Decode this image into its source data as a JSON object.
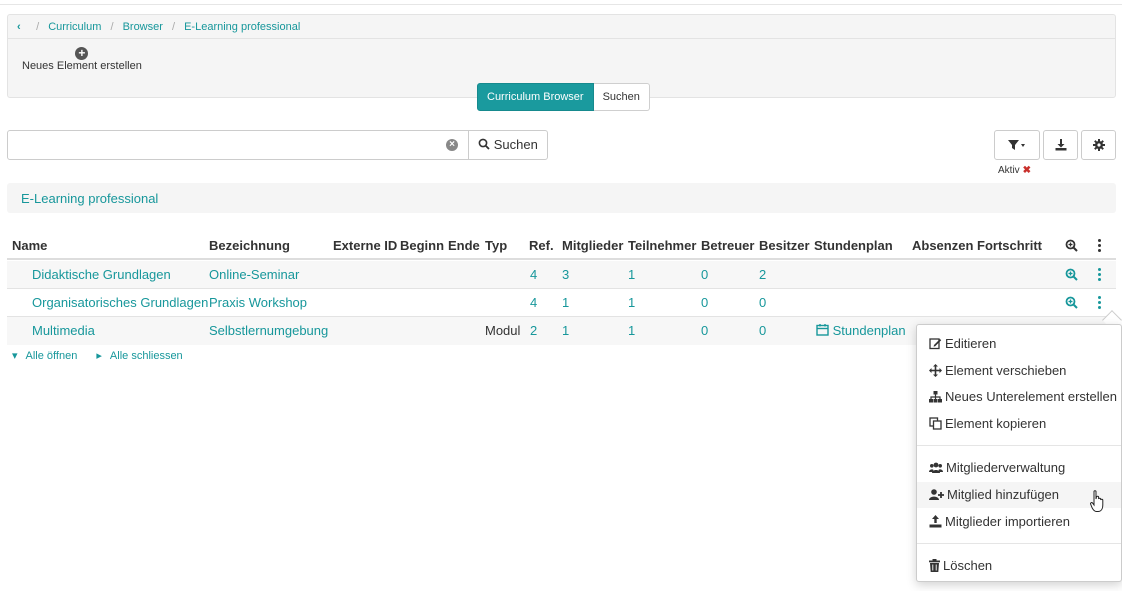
{
  "breadcrumb": [
    "Curriculum",
    "Browser",
    "E-Learning professional"
  ],
  "toolbar": {
    "new_element_label": "Neues Element erstellen"
  },
  "view_tabs": [
    {
      "label": "Curriculum Browser",
      "active": true
    },
    {
      "label": "Suchen",
      "active": false
    }
  ],
  "search": {
    "value": "",
    "placeholder": "",
    "button_label": "Suchen"
  },
  "filter": {
    "status_label": "Aktiv"
  },
  "section_title": "E-Learning professional",
  "table": {
    "headers": [
      "Name",
      "Bezeichnung",
      "Externe ID",
      "Beginn",
      "Ende",
      "Typ",
      "Ref.",
      "Mitglieder",
      "Teilnehmer",
      "Betreuer",
      "Besitzer",
      "Stundenplan",
      "Absenzen",
      "Fortschritt"
    ],
    "rows": [
      {
        "name": "Didaktische Grundlagen",
        "bezeichnung": "Online-Seminar",
        "typ": "",
        "ref": "4",
        "mitglieder": "3",
        "teilnehmer": "1",
        "betreuer": "0",
        "besitzer": "2",
        "stundenplan": ""
      },
      {
        "name": "Organisatorisches Grundlagen",
        "bezeichnung": "Praxis Workshop",
        "typ": "",
        "ref": "4",
        "mitglieder": "1",
        "teilnehmer": "1",
        "betreuer": "0",
        "besitzer": "0",
        "stundenplan": ""
      },
      {
        "name": "Multimedia",
        "bezeichnung": "Selbstlernumgebung",
        "typ": "Modul",
        "ref": "2",
        "mitglieder": "1",
        "teilnehmer": "1",
        "betreuer": "0",
        "besitzer": "0",
        "stundenplan": "Stundenplan"
      }
    ]
  },
  "tree_controls": {
    "expand_all": "Alle öffnen",
    "collapse_all": "Alle schliessen"
  },
  "context_menu": {
    "items": [
      {
        "label": "Editieren",
        "icon": "edit-icon"
      },
      {
        "label": "Element verschieben",
        "icon": "move-icon"
      },
      {
        "label": "Neues Unterelement erstellen",
        "icon": "sitemap-icon"
      },
      {
        "label": "Element kopieren",
        "icon": "copy-icon"
      },
      {
        "label": "Mitgliederverwaltung",
        "icon": "users-icon"
      },
      {
        "label": "Mitglied hinzufügen",
        "icon": "user-plus-icon"
      },
      {
        "label": "Mitglieder importieren",
        "icon": "upload-icon"
      },
      {
        "label": "Löschen",
        "icon": "trash-icon"
      }
    ]
  },
  "colors": {
    "accent": "#17979b",
    "active_tab": "#1a9a9e",
    "danger": "#c9302c"
  }
}
